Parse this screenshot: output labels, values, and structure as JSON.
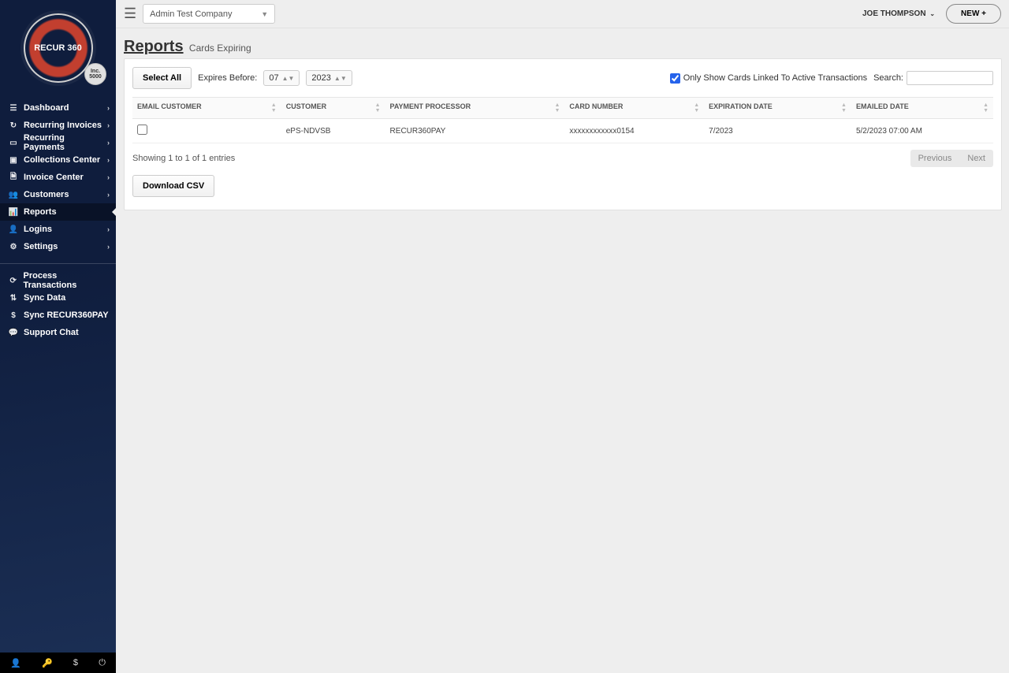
{
  "logo": {
    "text": "RECUR 360",
    "badge": "Inc. 5000"
  },
  "sidebar": {
    "items": [
      {
        "label": "Dashboard",
        "icon": "☰",
        "chev": true
      },
      {
        "label": "Recurring Invoices",
        "icon": "↻",
        "chev": true
      },
      {
        "label": "Recurring Payments",
        "icon": "▭",
        "chev": true
      },
      {
        "label": "Collections Center",
        "icon": "▣",
        "chev": true
      },
      {
        "label": "Invoice Center",
        "icon": "🗎",
        "chev": true
      },
      {
        "label": "Customers",
        "icon": "👥",
        "chev": true
      },
      {
        "label": "Reports",
        "icon": "📊",
        "chev": false,
        "active": true
      },
      {
        "label": "Logins",
        "icon": "👤",
        "chev": true
      },
      {
        "label": "Settings",
        "icon": "⚙",
        "chev": true
      }
    ],
    "items2": [
      {
        "label": "Process Transactions",
        "icon": "⟳"
      },
      {
        "label": "Sync Data",
        "icon": "⇅"
      },
      {
        "label": "Sync RECUR360PAY",
        "icon": "$"
      },
      {
        "label": "Support Chat",
        "icon": "💬"
      }
    ],
    "footer": {
      "user": "👤",
      "key": "🔑",
      "dollar": "$",
      "power": "⏻"
    }
  },
  "topbar": {
    "company": "Admin Test Company",
    "user": "JOE THOMPSON",
    "new_label": "NEW +"
  },
  "page": {
    "title": "Reports",
    "subtitle": "Cards Expiring"
  },
  "toolbar": {
    "select_all": "Select All",
    "expires_label": "Expires Before:",
    "month": "07",
    "year": "2023",
    "only_active_label": "Only Show Cards Linked To Active Transactions",
    "only_active_checked": true,
    "search_label": "Search:",
    "download_csv": "Download CSV"
  },
  "table": {
    "columns": [
      {
        "key": "email",
        "label": "EMAIL CUSTOMER"
      },
      {
        "key": "customer",
        "label": "CUSTOMER"
      },
      {
        "key": "processor",
        "label": "PAYMENT PROCESSOR"
      },
      {
        "key": "card",
        "label": "CARD NUMBER"
      },
      {
        "key": "exp",
        "label": "EXPIRATION DATE"
      },
      {
        "key": "emailed",
        "label": "EMAILED DATE"
      }
    ],
    "rows": [
      {
        "customer": "ePS-NDVSB",
        "processor": "RECUR360PAY",
        "card": "xxxxxxxxxxxx0154",
        "exp": "7/2023",
        "emailed": "5/2/2023 07:00 AM"
      }
    ],
    "info": "Showing 1 to 1 of 1 entries",
    "prev": "Previous",
    "next": "Next"
  }
}
